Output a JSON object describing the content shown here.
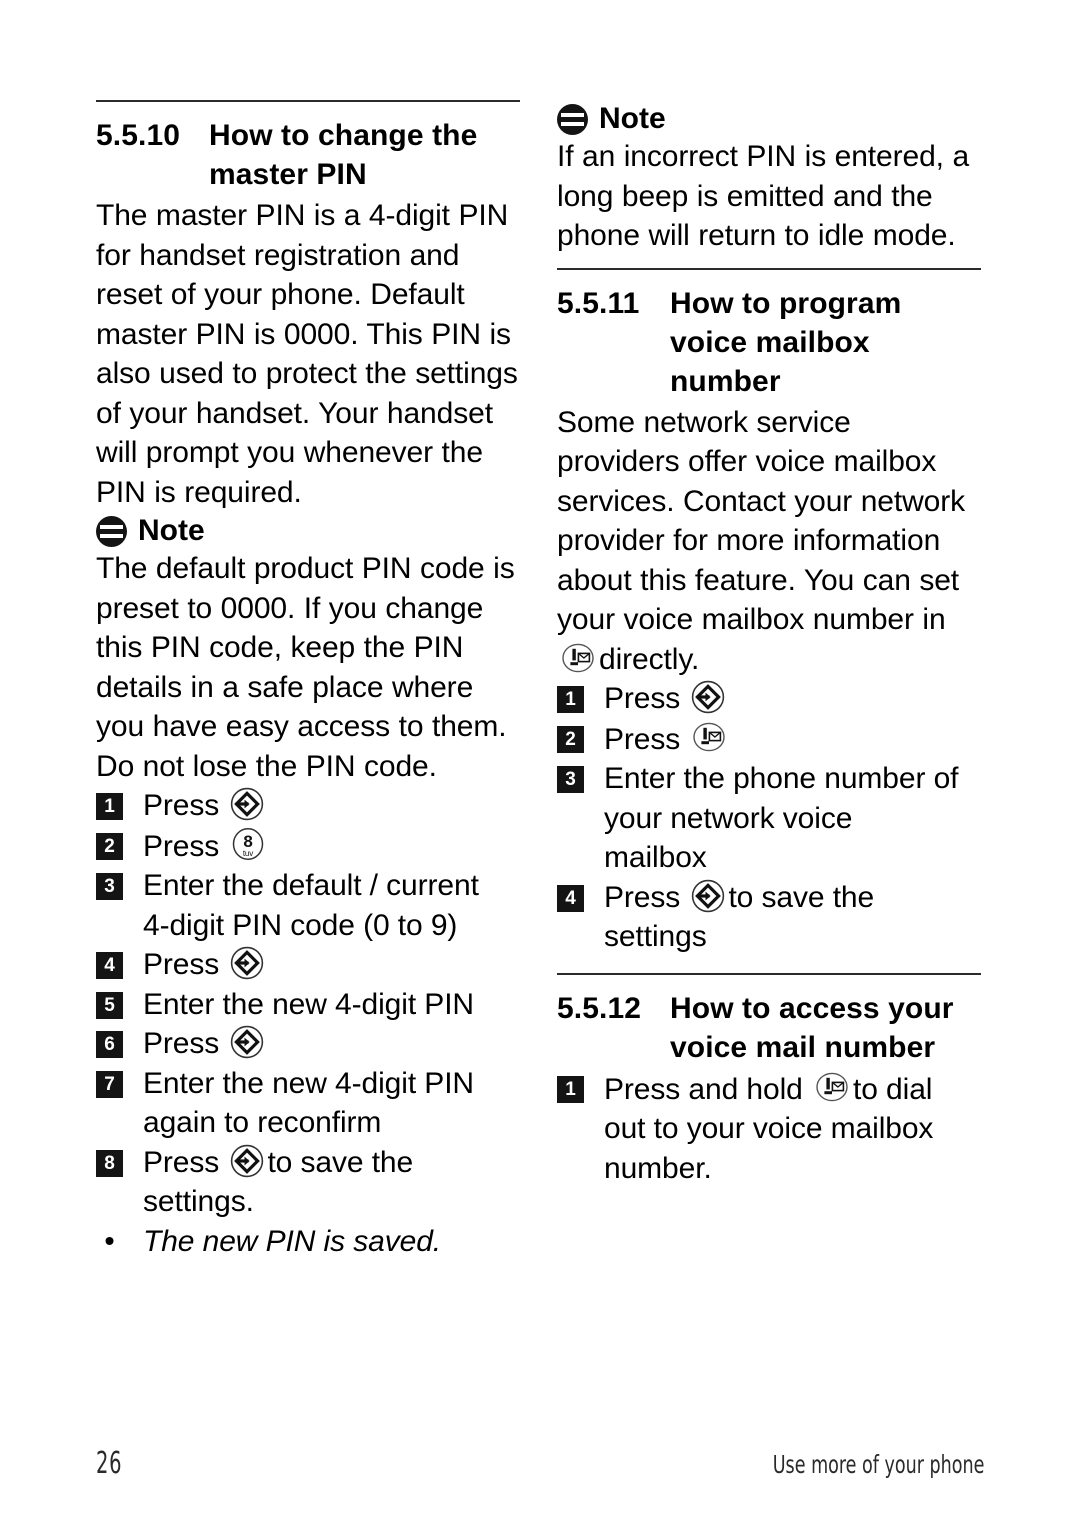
{
  "page": {
    "number": "26",
    "footer_title": "Use more of your phone"
  },
  "icons": {
    "note": "note-icon",
    "menu_key": "menu-select-key-icon",
    "key_8_tuv": "keypad-8-tuv-icon",
    "voicemail_key": "voicemail-key-icon"
  },
  "left_column": {
    "section": {
      "number": "5.5.10",
      "title_line1": "How to change the",
      "title_line2": "master PIN"
    },
    "intro_paragraph": "The master PIN is a 4-digit PIN for handset registration and reset of your phone. Default master PIN is 0000. This PIN is also used to protect the settings of your handset. Your handset will prompt you whenever the PIN is required.",
    "note": {
      "label": "Note",
      "text": "The default product PIN code is preset to 0000. If you change this PIN code, keep the PIN details in a safe place where you have easy access to them. Do not lose the PIN code."
    },
    "steps": [
      {
        "num": "1",
        "text_before": "Press",
        "icon": "menu-select-key-icon",
        "text_after": ""
      },
      {
        "num": "2",
        "text_before": "Press",
        "icon": "keypad-8-tuv-icon",
        "text_after": ""
      },
      {
        "num": "3",
        "text_before": "Enter the default / current",
        "icon": "",
        "text_after": "",
        "continuation": "4-digit PIN code (0 to 9)"
      },
      {
        "num": "4",
        "text_before": "Press",
        "icon": "menu-select-key-icon",
        "text_after": ""
      },
      {
        "num": "5",
        "text_before": "Enter the new 4-digit PIN",
        "icon": "",
        "text_after": ""
      },
      {
        "num": "6",
        "text_before": "Press",
        "icon": "menu-select-key-icon",
        "text_after": ""
      },
      {
        "num": "7",
        "text_before": "Enter the new 4-digit PIN",
        "icon": "",
        "text_after": "",
        "continuation": "again to reconfirm"
      },
      {
        "num": "8",
        "text_before": "Press",
        "icon": "menu-select-key-icon",
        "text_after": "to save the",
        "continuation": "settings."
      },
      {
        "num": "•",
        "text_before": "The new PIN is saved.",
        "icon": "",
        "text_after": "",
        "italic": true
      }
    ]
  },
  "right_column": {
    "note": {
      "label": "Note",
      "text": "If an incorrect PIN is entered, a long beep is emitted and the phone will return to idle mode."
    },
    "section_11": {
      "number": "5.5.11",
      "title_line1": "How to program",
      "title_line2": "voice mailbox",
      "title_line3": "number",
      "paragraph_before_icon": "Some network service providers offer voice mailbox services. Contact your network provider for more information about this feature. You can set your voice mailbox number in",
      "paragraph_after_icon": "directly.",
      "steps": [
        {
          "num": "1",
          "text_before": "Press",
          "icon": "menu-select-key-icon",
          "text_after": ""
        },
        {
          "num": "2",
          "text_before": "Press",
          "icon": "voicemail-key-icon",
          "text_after": ""
        },
        {
          "num": "3",
          "text_before": "Enter the phone number of",
          "icon": "",
          "text_after": "",
          "continuation": "your network voice",
          "continuation2": "mailbox"
        },
        {
          "num": "4",
          "text_before": "Press",
          "icon": "menu-select-key-icon",
          "text_after": "to save the",
          "continuation": "settings"
        }
      ]
    },
    "section_12": {
      "number": "5.5.12",
      "title_line1": "How to access your",
      "title_line2": "voice mail number",
      "steps": [
        {
          "num": "1",
          "text_before": "Press and hold",
          "icon": "voicemail-key-icon",
          "text_after": "to dial",
          "continuation": "out to your voice mailbox",
          "continuation2": "number."
        }
      ]
    }
  }
}
